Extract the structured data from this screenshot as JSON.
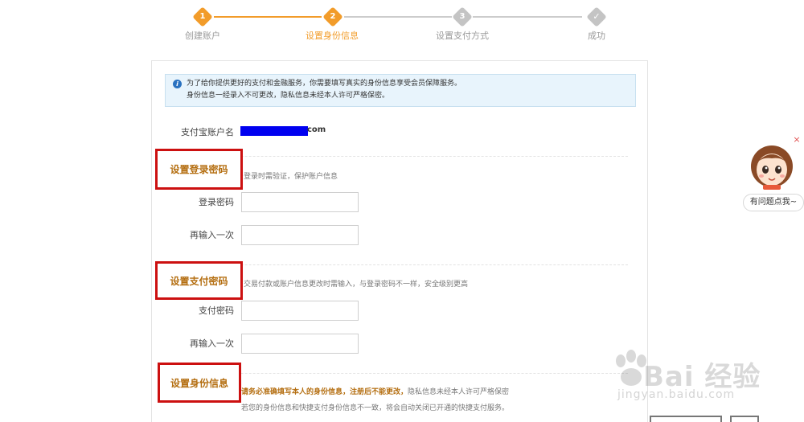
{
  "steps": [
    {
      "num": "1",
      "label": "创建账户",
      "state": "done"
    },
    {
      "num": "2",
      "label": "设置身份信息",
      "state": "active"
    },
    {
      "num": "3",
      "label": "设置支付方式",
      "state": "todo"
    },
    {
      "num": "",
      "label": "成功",
      "state": "todo"
    }
  ],
  "notice": {
    "line1": "为了给你提供更好的支付和金融服务，你需要填写真实的身份信息享受会员保障服务。",
    "line2": "身份信息一经录入不可更改，隐私信息未经本人许可严格保密。"
  },
  "account": {
    "label": "支付宝账户名",
    "suffix": "com"
  },
  "login_section": {
    "title": "设置登录密码",
    "desc": "登录时需验证，保护账户信息",
    "field1_label": "登录密码",
    "field2_label": "再输入一次"
  },
  "pay_section": {
    "title": "设置支付密码",
    "desc": "交易付款或账户信息更改时需输入，与登录密码不一样，安全级别更高",
    "field1_label": "支付密码",
    "field2_label": "再输入一次"
  },
  "identity_section": {
    "title": "设置身份信息",
    "desc1_warn": "请务必准确填写本人的身份信息，注册后不能更改，",
    "desc1_plain": "隐私信息未经本人许可严格保密",
    "desc2": "若您的身份信息和快捷支付身份信息不一致，将会自动关闭已开通的快捷支付服务。"
  },
  "helper": {
    "label": "有问题点我~",
    "close": "×"
  },
  "watermark": {
    "main": "Bai  经验",
    "sub": "jingyan.baidu.com"
  },
  "colors": {
    "accent": "#f29c2a",
    "highlight_border": "#cc1010",
    "section_title": "#b46e10"
  }
}
